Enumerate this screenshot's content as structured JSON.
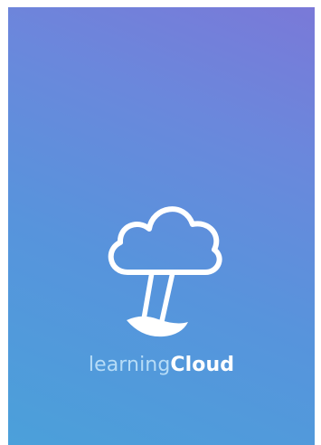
{
  "app": {
    "brand_prefix": "learning",
    "brand_suffix": "Cloud",
    "logo_icon": "cloud-balloon-icon"
  },
  "colors": {
    "gradient_top": "#7a79d8",
    "gradient_bottom": "#4ba0da",
    "brand_light": "#b6dcf7",
    "brand_bold": "#ffffff",
    "icon_stroke": "#ffffff"
  }
}
